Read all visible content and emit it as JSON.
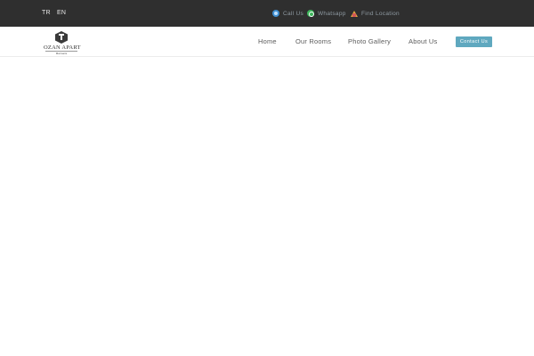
{
  "topbar": {
    "languages": [
      "TR",
      "EN"
    ],
    "links": [
      {
        "label": "Call Us",
        "icon": "phone-icon"
      },
      {
        "label": "Whatsapp",
        "icon": "whatsapp-icon"
      },
      {
        "label": "Find Location",
        "icon": "location-icon"
      }
    ]
  },
  "logo": {
    "name": "OZAN APART",
    "subtitle": "Marmaris"
  },
  "nav": {
    "items": [
      "Home",
      "Our Rooms",
      "Photo Gallery",
      "About Us"
    ],
    "contact_label": "Contact Us"
  },
  "colors": {
    "topbar_bg": "#2f2f2f",
    "accent": "#5fa8bf",
    "nav_text": "#5b5b5b"
  }
}
